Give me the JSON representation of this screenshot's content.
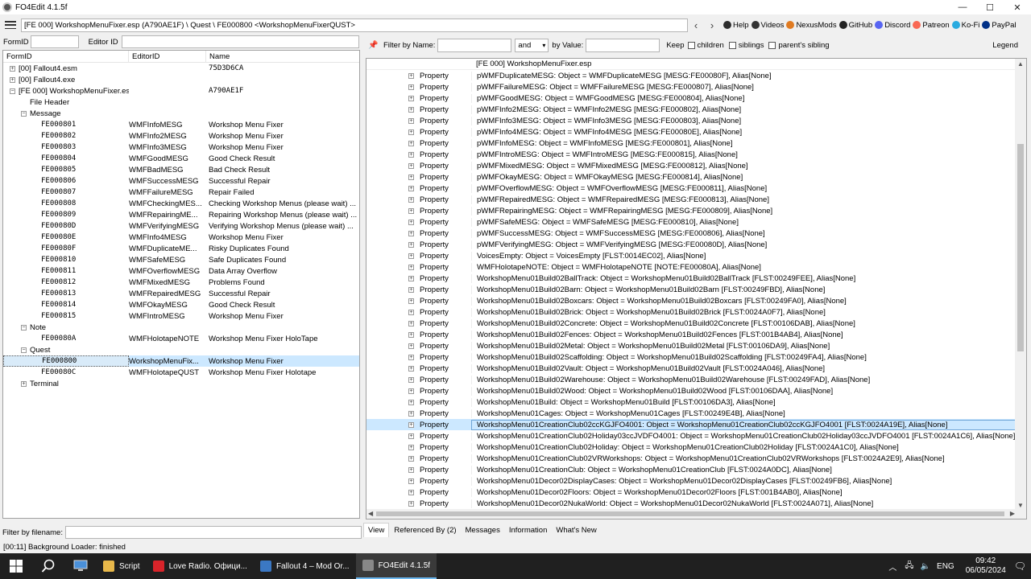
{
  "window": {
    "title": "FO4Edit 4.1.5f",
    "min": "—",
    "max": "☐",
    "close": "✕"
  },
  "toolbar": {
    "path": "[FE 000] WorkshopMenuFixer.esp (A790AE1F) \\ Quest \\ FE000800 <WorkshopMenuFixerQUST>",
    "back": "‹",
    "forward": "›",
    "links": [
      {
        "label": "Help",
        "color": "#2d2d2d"
      },
      {
        "label": "Videos",
        "color": "#333"
      },
      {
        "label": "NexusMods",
        "color": "#e07b22"
      },
      {
        "label": "GitHub",
        "color": "#222"
      },
      {
        "label": "Discord",
        "color": "#5865f2"
      },
      {
        "label": "Patreon",
        "color": "#f96854"
      },
      {
        "label": "Ko-Fi",
        "color": "#29abe0"
      },
      {
        "label": "PayPal",
        "color": "#003087"
      }
    ]
  },
  "left": {
    "formid_label": "FormID",
    "editorid_label": "Editor ID",
    "columns": [
      "FormID",
      "EditorID",
      "Name"
    ],
    "rows": [
      {
        "indent": 0,
        "exp": "+",
        "c1": "[00] Fallout4.esm",
        "c2": "",
        "c3": "75D3D6CA",
        "mono": false
      },
      {
        "indent": 0,
        "exp": "+",
        "c1": "[00] Fallout4.exe",
        "c2": "",
        "c3": "",
        "mono": false
      },
      {
        "indent": 0,
        "exp": "−",
        "c1": "[FE 000] WorkshopMenuFixer.esp",
        "c2": "",
        "c3": "A790AE1F",
        "mono": false
      },
      {
        "indent": 1,
        "exp": "",
        "c1": "File Header",
        "c2": "",
        "c3": "",
        "mono": false
      },
      {
        "indent": 1,
        "exp": "−",
        "c1": "Message",
        "c2": "",
        "c3": "",
        "mono": false
      },
      {
        "indent": 2,
        "exp": "",
        "c1": "FE000801",
        "c2": "WMFInfoMESG",
        "c3": "Workshop Menu Fixer",
        "mono": true
      },
      {
        "indent": 2,
        "exp": "",
        "c1": "FE000802",
        "c2": "WMFInfo2MESG",
        "c3": "Workshop Menu Fixer",
        "mono": true
      },
      {
        "indent": 2,
        "exp": "",
        "c1": "FE000803",
        "c2": "WMFInfo3MESG",
        "c3": "Workshop Menu Fixer",
        "mono": true
      },
      {
        "indent": 2,
        "exp": "",
        "c1": "FE000804",
        "c2": "WMFGoodMESG",
        "c3": "Good Check Result",
        "mono": true
      },
      {
        "indent": 2,
        "exp": "",
        "c1": "FE000805",
        "c2": "WMFBadMESG",
        "c3": "Bad Check Result",
        "mono": true
      },
      {
        "indent": 2,
        "exp": "",
        "c1": "FE000806",
        "c2": "WMFSuccessMESG",
        "c3": "Successful Repair",
        "mono": true
      },
      {
        "indent": 2,
        "exp": "",
        "c1": "FE000807",
        "c2": "WMFFailureMESG",
        "c3": "Repair Failed",
        "mono": true
      },
      {
        "indent": 2,
        "exp": "",
        "c1": "FE000808",
        "c2": "WMFCheckingMES...",
        "c3": "Checking Workshop Menus (please wait) ...",
        "mono": true
      },
      {
        "indent": 2,
        "exp": "",
        "c1": "FE000809",
        "c2": "WMFRepairingME...",
        "c3": "Repairing Workshop Menus (please wait) ...",
        "mono": true
      },
      {
        "indent": 2,
        "exp": "",
        "c1": "FE00080D",
        "c2": "WMFVerifyingMESG",
        "c3": "Verifying Workshop Menus (please wait) ...",
        "mono": true
      },
      {
        "indent": 2,
        "exp": "",
        "c1": "FE00080E",
        "c2": "WMFInfo4MESG",
        "c3": "Workshop Menu Fixer",
        "mono": true
      },
      {
        "indent": 2,
        "exp": "",
        "c1": "FE00080F",
        "c2": "WMFDuplicateME...",
        "c3": "Risky Duplicates Found",
        "mono": true
      },
      {
        "indent": 2,
        "exp": "",
        "c1": "FE000810",
        "c2": "WMFSafeMESG",
        "c3": "Safe Duplicates Found",
        "mono": true
      },
      {
        "indent": 2,
        "exp": "",
        "c1": "FE000811",
        "c2": "WMFOverflowMESG",
        "c3": "Data Array Overflow",
        "mono": true
      },
      {
        "indent": 2,
        "exp": "",
        "c1": "FE000812",
        "c2": "WMFMixedMESG",
        "c3": "Problems Found",
        "mono": true
      },
      {
        "indent": 2,
        "exp": "",
        "c1": "FE000813",
        "c2": "WMFRepairedMESG",
        "c3": "Successful Repair",
        "mono": true
      },
      {
        "indent": 2,
        "exp": "",
        "c1": "FE000814",
        "c2": "WMFOkayMESG",
        "c3": "Good Check Result",
        "mono": true
      },
      {
        "indent": 2,
        "exp": "",
        "c1": "FE000815",
        "c2": "WMFIntroMESG",
        "c3": "Workshop Menu Fixer",
        "mono": true
      },
      {
        "indent": 1,
        "exp": "−",
        "c1": "Note",
        "c2": "",
        "c3": "",
        "mono": false
      },
      {
        "indent": 2,
        "exp": "",
        "c1": "FE00080A",
        "c2": "WMFHolotapeNOTE",
        "c3": "Workshop Menu Fixer HoloTape",
        "mono": true
      },
      {
        "indent": 1,
        "exp": "−",
        "c1": "Quest",
        "c2": "",
        "c3": "",
        "mono": false
      },
      {
        "indent": 2,
        "exp": "",
        "c1": "FE000800",
        "c2": "WorkshopMenuFix...",
        "c3": "Workshop Menu Fixer",
        "mono": true,
        "sel": true
      },
      {
        "indent": 2,
        "exp": "",
        "c1": "FE00080C",
        "c2": "WMFHolotapeQUST",
        "c3": "Workshop Menu Fixer Holotape",
        "mono": true
      },
      {
        "indent": 1,
        "exp": "+",
        "c1": "Terminal",
        "c2": "",
        "c3": "",
        "mono": false
      }
    ],
    "filter_label": "Filter by filename:"
  },
  "right": {
    "filter_name_label": "Filter by Name:",
    "and_value": "and",
    "by_value_label": "by Value:",
    "keep_label": "Keep",
    "children_label": "children",
    "siblings_label": "siblings",
    "parents_sibling_label": "parent's sibling",
    "legend_label": "Legend",
    "header": "[FE 000] WorkshopMenuFixer.esp",
    "prop_label": "Property",
    "rows": [
      "pWMFDuplicateMESG: Object = WMFDuplicateMESG [MESG:FE00080F], Alias[None]",
      "pWMFFailureMESG: Object = WMFFailureMESG [MESG:FE000807], Alias[None]",
      "pWMFGoodMESG: Object = WMFGoodMESG [MESG:FE000804], Alias[None]",
      "pWMFInfo2MESG: Object = WMFInfo2MESG [MESG:FE000802], Alias[None]",
      "pWMFInfo3MESG: Object = WMFInfo3MESG [MESG:FE000803], Alias[None]",
      "pWMFInfo4MESG: Object = WMFInfo4MESG [MESG:FE00080E], Alias[None]",
      "pWMFInfoMESG: Object = WMFInfoMESG [MESG:FE000801], Alias[None]",
      "pWMFIntroMESG: Object = WMFIntroMESG [MESG:FE000815], Alias[None]",
      "pWMFMixedMESG: Object = WMFMixedMESG [MESG:FE000812], Alias[None]",
      "pWMFOkayMESG: Object = WMFOkayMESG [MESG:FE000814], Alias[None]",
      "pWMFOverflowMESG: Object = WMFOverflowMESG [MESG:FE000811], Alias[None]",
      "pWMFRepairedMESG: Object = WMFRepairedMESG [MESG:FE000813], Alias[None]",
      "pWMFRepairingMESG: Object = WMFRepairingMESG [MESG:FE000809], Alias[None]",
      "pWMFSafeMESG: Object = WMFSafeMESG [MESG:FE000810], Alias[None]",
      "pWMFSuccessMESG: Object = WMFSuccessMESG [MESG:FE000806], Alias[None]",
      "pWMFVerifyingMESG: Object = WMFVerifyingMESG [MESG:FE00080D], Alias[None]",
      "VoicesEmpty: Object = VoicesEmpty [FLST:0014EC02], Alias[None]",
      "WMFHolotapeNOTE: Object = WMFHolotapeNOTE [NOTE:FE00080A], Alias[None]",
      "WorkshopMenu01Build02BallTrack: Object = WorkshopMenu01Build02BallTrack [FLST:00249FEE], Alias[None]",
      "WorkshopMenu01Build02Barn: Object = WorkshopMenu01Build02Barn [FLST:00249FBD], Alias[None]",
      "WorkshopMenu01Build02Boxcars: Object = WorkshopMenu01Build02Boxcars [FLST:00249FA0], Alias[None]",
      "WorkshopMenu01Build02Brick: Object = WorkshopMenu01Build02Brick [FLST:0024A0F7], Alias[None]",
      "WorkshopMenu01Build02Concrete: Object = WorkshopMenu01Build02Concrete [FLST:00106DAB], Alias[None]",
      "WorkshopMenu01Build02Fences: Object = WorkshopMenu01Build02Fences [FLST:001B4AB4], Alias[None]",
      "WorkshopMenu01Build02Metal: Object = WorkshopMenu01Build02Metal [FLST:00106DA9], Alias[None]",
      "WorkshopMenu01Build02Scaffolding: Object = WorkshopMenu01Build02Scaffolding [FLST:00249FA4], Alias[None]",
      "WorkshopMenu01Build02Vault: Object = WorkshopMenu01Build02Vault [FLST:0024A046], Alias[None]",
      "WorkshopMenu01Build02Warehouse: Object = WorkshopMenu01Build02Warehouse [FLST:00249FAD], Alias[None]",
      "WorkshopMenu01Build02Wood: Object = WorkshopMenu01Build02Wood [FLST:00106DAA], Alias[None]",
      "WorkshopMenu01Build: Object = WorkshopMenu01Build [FLST:00106DA3], Alias[None]",
      "WorkshopMenu01Cages: Object = WorkshopMenu01Cages [FLST:00249E4B], Alias[None]",
      "WorkshopMenu01CreationClub02ccKGJFO4001: Object = WorkshopMenu01CreationClub02ccKGJFO4001 [FLST:0024A19E], Alias[None]",
      "WorkshopMenu01CreationClub02Holiday03ccJVDFO4001: Object = WorkshopMenu01CreationClub02Holiday03ccJVDFO4001 [FLST:0024A1C6], Alias[None]",
      "WorkshopMenu01CreationClub02Holiday: Object = WorkshopMenu01CreationClub02Holiday [FLST:0024A1C0], Alias[None]",
      "WorkshopMenu01CreationClub02VRWorkshops: Object = WorkshopMenu01CreationClub02VRWorkshops [FLST:0024A2E9], Alias[None]",
      "WorkshopMenu01CreationClub: Object = WorkshopMenu01CreationClub [FLST:0024A0DC], Alias[None]",
      "WorkshopMenu01Decor02DisplayCases: Object = WorkshopMenu01Decor02DisplayCases [FLST:00249FB6], Alias[None]",
      "WorkshopMenu01Decor02Floors: Object = WorkshopMenu01Decor02Floors [FLST:001B4AB0], Alias[None]",
      "WorkshopMenu01Decor02NukaWorld: Object = WorkshopMenu01Decor02NukaWorld [FLST:0024A071], Alias[None]"
    ],
    "selected_index": 31,
    "tabs": [
      "View",
      "Referenced By (2)",
      "Messages",
      "Information",
      "What's New"
    ]
  },
  "status": "[00:11] Background Loader: finished",
  "taskbar": {
    "items": [
      {
        "label": "Script",
        "color": "#e8b84a"
      },
      {
        "label": "Love Radio. Офици...",
        "color": "#d9242a"
      },
      {
        "label": "Fallout 4 – Mod Or...",
        "color": "#3b78c4"
      },
      {
        "label": "FO4Edit 4.1.5f",
        "color": "#888"
      }
    ],
    "time": "09:42",
    "date": "06/05/2024"
  }
}
